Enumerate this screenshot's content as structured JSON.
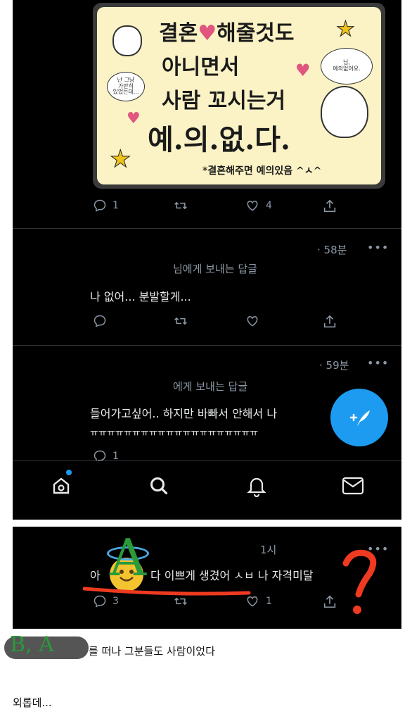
{
  "meme": {
    "line1": "결혼",
    "line1b": "해줄것도",
    "line2": "아니면서",
    "line3": "사람 꼬시는거",
    "line4": "예.의.없.다.",
    "footnote": "*결혼해주면 예의있음 ^ㅅ^",
    "bubble_right_a": "님,",
    "bubble_right_b": "예의없어요.",
    "bubble_left_a": "난 그냥",
    "bubble_left_b": "가만히",
    "bubble_left_c": "있었는데..."
  },
  "tweet1_actions": {
    "reply_count": "1",
    "like_count": "4"
  },
  "tweet2": {
    "time": "· 58분",
    "reply_to": "님에게 보내는 답글",
    "text": "나 없어... 분발할게..."
  },
  "tweet3": {
    "time": "· 59분",
    "reply_to": "에게 보내는 답글",
    "text_line1": "들어가고싶어.. 하지만 바빠서 안해서 나",
    "text_line2": "ㅠㅠㅠㅠㅠㅠㅠㅠㅠㅠㅠㅠㅠㅠㅠㅠㅠㅠㅠㅠ",
    "reply_count": "1"
  },
  "tweet4": {
    "time": "1시",
    "text_a": "아",
    "text_b": "다 이쁘게 생겼어 ㅅㅂ 나 자격미달",
    "reply_count": "3",
    "like_count": "1"
  },
  "annotations": {
    "letter_a": "A",
    "marks_bottom": "B, A"
  },
  "caption": "를 떠나 그분들도 사람이었다",
  "bottom_text": "외롭데...",
  "colors": {
    "accent": "#1d9bf0",
    "background": "#000000",
    "muted": "#8b98a5",
    "annotation_green": "#2a9a3a",
    "annotation_red": "#ee3a20"
  }
}
